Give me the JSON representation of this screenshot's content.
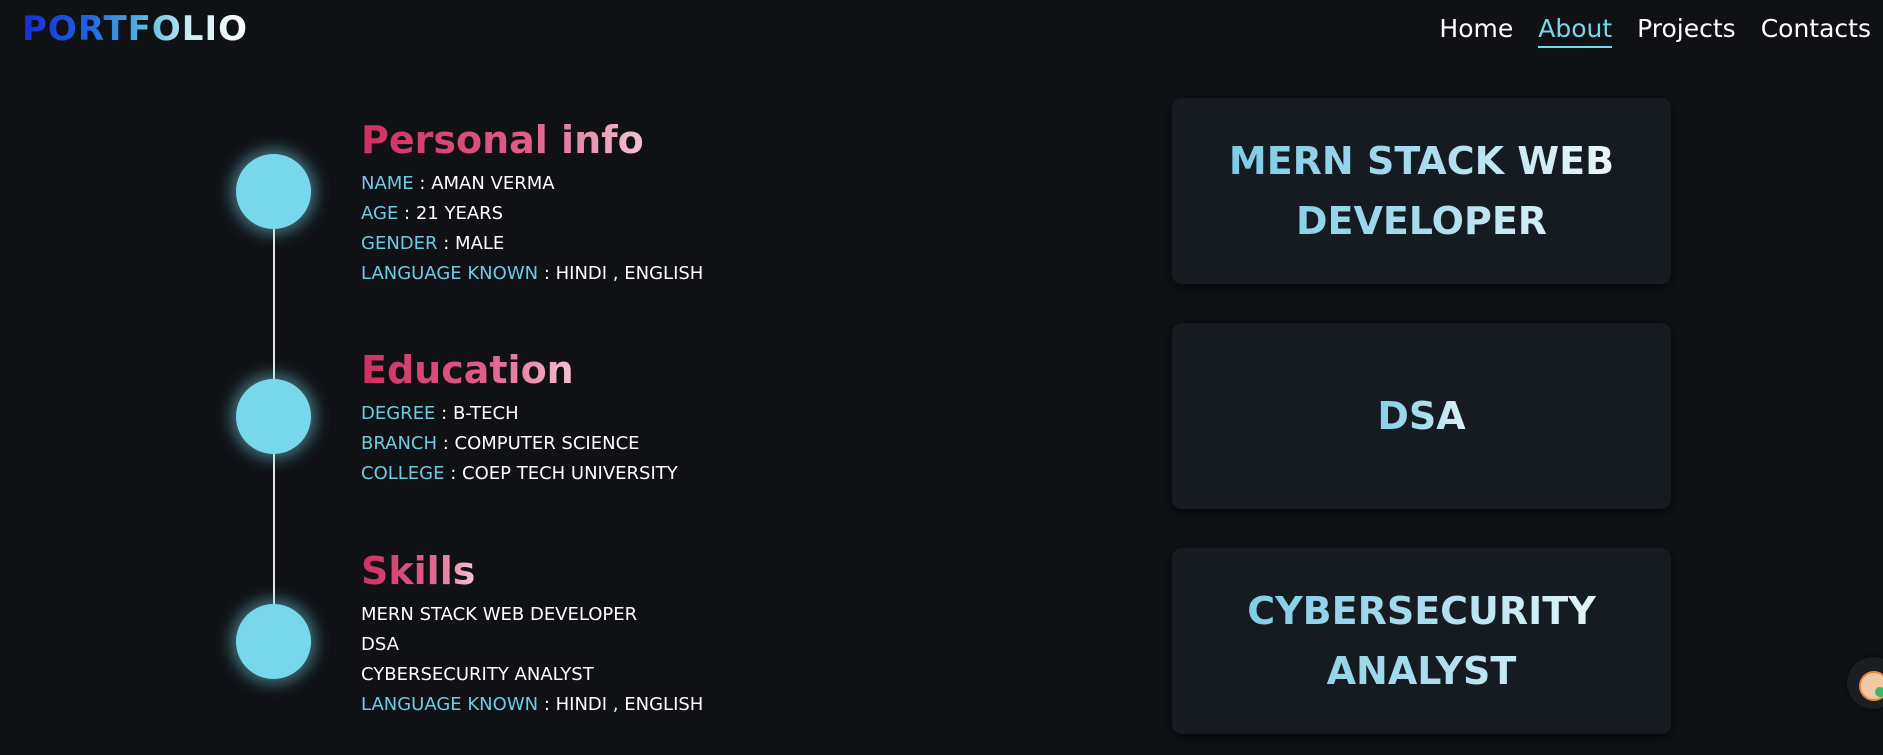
{
  "header": {
    "logo": "PORTFOLIO",
    "nav": [
      {
        "label": "Home"
      },
      {
        "label": "About"
      },
      {
        "label": "Projects"
      },
      {
        "label": "Contacts"
      }
    ],
    "active_nav": "About"
  },
  "timeline": {
    "personal": {
      "title": "Personal info",
      "rows": [
        {
          "key": "NAME",
          "sep": " : ",
          "value": "AMAN VERMA"
        },
        {
          "key": "AGE",
          "sep": " : ",
          "value": "21 YEARS"
        },
        {
          "key": "GENDER",
          "sep": " : ",
          "value": "MALE"
        },
        {
          "key": "LANGUAGE KNOWN",
          "sep": " : ",
          "value": "HINDI , ENGLISH"
        }
      ]
    },
    "education": {
      "title": "Education",
      "rows": [
        {
          "key": "DEGREE",
          "sep": " : ",
          "value": "B-TECH"
        },
        {
          "key": "BRANCH",
          "sep": " : ",
          "value": "COMPUTER SCIENCE"
        },
        {
          "key": "COLLEGE",
          "sep": " : ",
          "value": "COEP TECH UNIVERSITY"
        }
      ]
    },
    "skills": {
      "title": "Skills",
      "items": [
        "MERN STACK WEB DEVELOPER",
        "DSA",
        "CYBERSECURITY ANALYST"
      ],
      "extra": {
        "key": "LANGUAGE KNOWN",
        "sep": " : ",
        "value": "HINDI , ENGLISH"
      }
    }
  },
  "cards": [
    {
      "label": "MERN STACK WEB DEVELOPER"
    },
    {
      "label": "DSA"
    },
    {
      "label": "CYBERSECURITY ANALYST"
    }
  ],
  "colors": {
    "background": "#0f1115",
    "accent": "#79d6ea",
    "title_pink": "#cf2f5f",
    "card_bg": "#161b22"
  },
  "icons": {
    "floating_widget": "avatar-chat-icon"
  }
}
